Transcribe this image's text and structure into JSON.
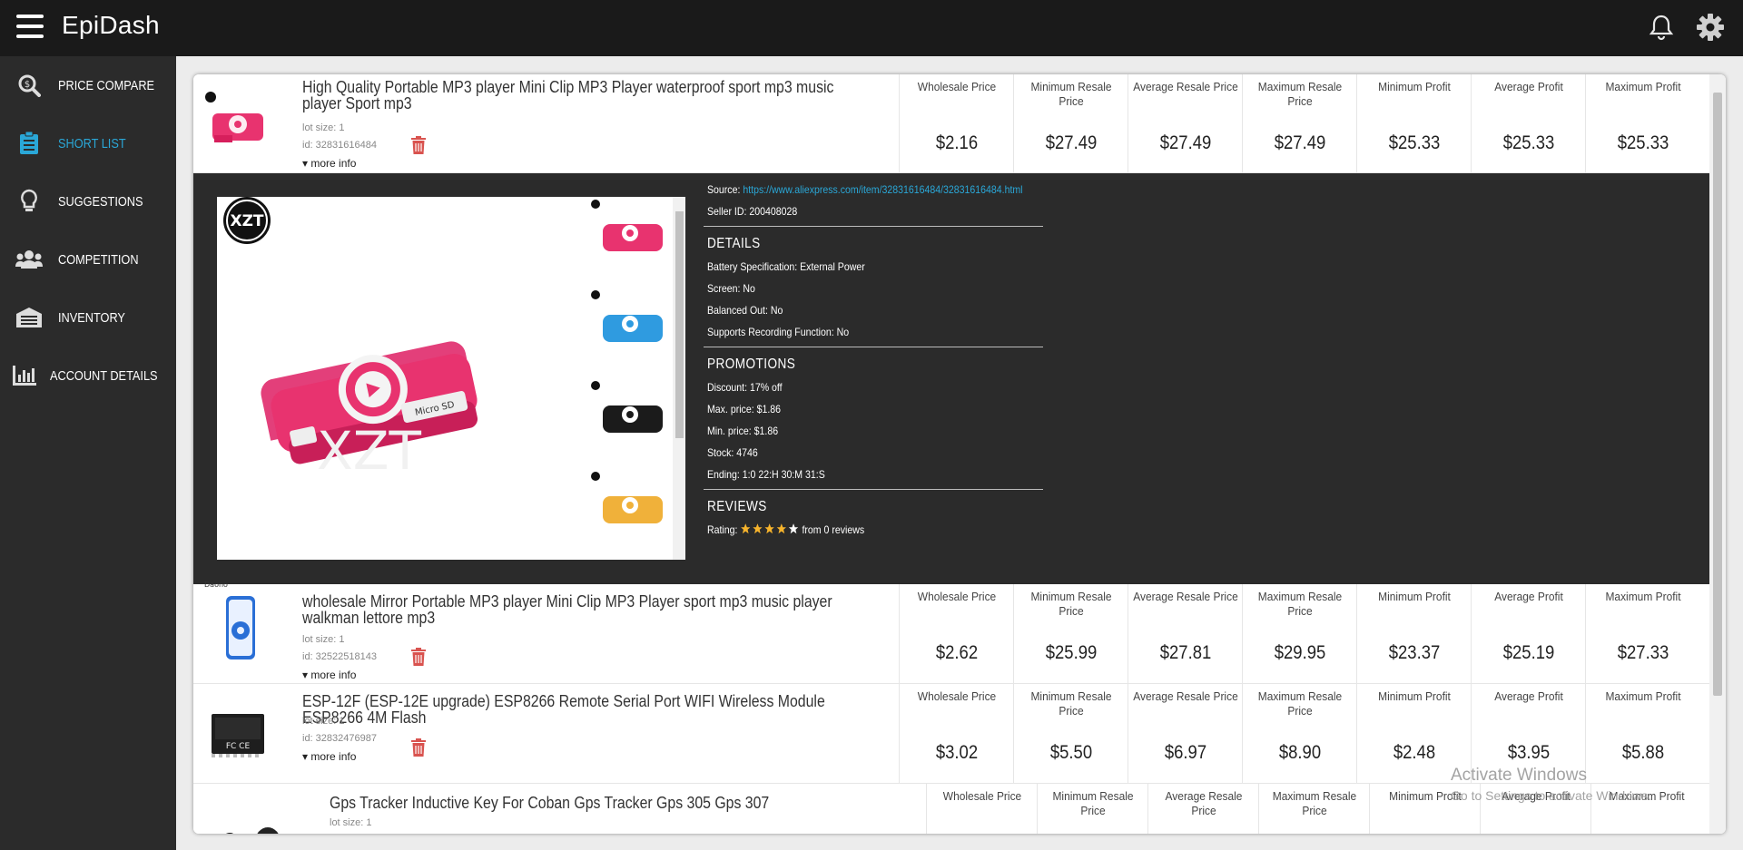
{
  "app": {
    "title": "EpiDash"
  },
  "header": {
    "menu_icon": "hamburger-icon",
    "icons": [
      "bell-icon",
      "gear-icon"
    ]
  },
  "sidebar": {
    "items": [
      {
        "label": "PRICE COMPARE",
        "icon": "price-compare-icon",
        "active": false
      },
      {
        "label": "SHORT LIST",
        "icon": "clipboard-icon",
        "active": true
      },
      {
        "label": "SUGGESTIONS",
        "icon": "lightbulb-icon",
        "active": false
      },
      {
        "label": "COMPETITION",
        "icon": "users-icon",
        "active": false
      },
      {
        "label": "INVENTORY",
        "icon": "warehouse-icon",
        "active": false
      },
      {
        "label": "ACCOUNT DETAILS",
        "icon": "bar-chart-icon",
        "active": false
      }
    ]
  },
  "metric_labels": [
    "Wholesale Price",
    "Minimum Resale Price",
    "Average Resale Price",
    "Maximum Resale Price",
    "Minimum Profit",
    "Average Profit",
    "Maximum Profit"
  ],
  "products": [
    {
      "title": "High Quality Portable MP3 player Mini Clip MP3 Player waterproof sport mp3 music player Sport mp3",
      "lot": "lot size: 1",
      "id": "id: 32831616484",
      "more": "more info",
      "values": [
        "$2.16",
        "$27.49",
        "$27.49",
        "$27.49",
        "$25.33",
        "$25.33",
        "$25.33"
      ]
    },
    {
      "title": "wholesale Mirror Portable MP3 player Mini Clip MP3 Player sport mp3 music player walkman lettore mp3",
      "lot": "lot size: 1",
      "id": "id: 32522518143",
      "more": "more info",
      "brand_tag": "Daono",
      "values": [
        "$2.62",
        "$25.99",
        "$27.81",
        "$29.95",
        "$23.37",
        "$25.19",
        "$27.33"
      ]
    },
    {
      "title": "ESP-12F (ESP-12E upgrade) ESP8266 Remote Serial Port WIFI Wireless Module ESP8266 4M Flash",
      "lot": "lot size: 1",
      "id": "id: 32832476987",
      "more": "more info",
      "values": [
        "$3.02",
        "$5.50",
        "$6.97",
        "$8.90",
        "$2.48",
        "$3.95",
        "$5.88"
      ]
    },
    {
      "title": "Gps Tracker Inductive Key For Coban Gps Tracker Gps 305 Gps 307",
      "lot": "lot size: 1"
    }
  ],
  "details": {
    "source_label": "Source:",
    "source_url": "https://www.aliexpress.com/item/32831616484/32831616484.html",
    "seller": "Seller ID: 200408028",
    "details_heading": "DETAILS",
    "details_lines": [
      "Battery Specification: External Power",
      "Screen: No",
      "Balanced Out: No",
      "Supports Recording Function: No"
    ],
    "promotions_heading": "PROMOTIONS",
    "promotions_lines": [
      "Discount: 17% off",
      "Max. price: $1.86",
      "Min. price: $1.86",
      "Stock: 4746",
      "Ending: 1:0 22:H 30:M 31:S"
    ],
    "reviews_heading": "REVIEWS",
    "rating_label": "Rating:",
    "rating_value": 4,
    "rating_max": 5,
    "reviews_count": "from 0 reviews",
    "gallery_logo": "XZT",
    "main_image_text": "Micro SD",
    "thumb_colors": [
      "#e8336f",
      "#2f9be0",
      "#1b1b1b",
      "#f0b13a"
    ]
  },
  "watermark": {
    "title": "Activate Windows",
    "sub": "Go to Settings to activate Windows."
  },
  "colors": {
    "accent": "#2aa7d7",
    "trash": "#d9534f",
    "star": "#f7b42c"
  }
}
